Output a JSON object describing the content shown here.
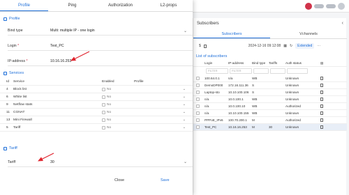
{
  "background": {
    "panel_title": "Subscribers",
    "tabs": [
      {
        "label": "Subscribers",
        "active": true
      },
      {
        "label": "Vchannels",
        "active": false
      }
    ],
    "toolbar": {
      "date": "2024-12-16 09:12:08",
      "extended_label": "Extended"
    },
    "list_title": "List of subscribers",
    "columns": [
      "Login",
      "IP-address",
      "Bind type",
      "Tariffs",
      "Auth status"
    ],
    "filter_placeholder": "FILTER",
    "rows": [
      {
        "login": "100.64.0.1",
        "ip": "n/a",
        "bind": "WB",
        "tariff": "",
        "status": "Unknown",
        "selected": false
      },
      {
        "login": "DemoDP000",
        "ip": "172.16.111.36",
        "bind": "S",
        "tariff": "",
        "status": "Unknown",
        "selected": false
      },
      {
        "login": "Laptop-sto",
        "ip": "10.10.100.106",
        "bind": "S",
        "tariff": "",
        "status": "Unknown",
        "selected": false
      },
      {
        "login": "n/a",
        "ip": "10.0.100.1",
        "bind": "WB",
        "tariff": "",
        "status": "Unknown",
        "selected": false
      },
      {
        "login": "n/a",
        "ip": "10.0.100.10",
        "bind": "WB",
        "tariff": "",
        "status": "Authorized",
        "selected": false
      },
      {
        "login": "n/a",
        "ip": "10.10.100.155",
        "bind": "WB",
        "tariff": "",
        "status": "Unknown",
        "selected": false
      },
      {
        "login": "PPPoE_IPv6",
        "ip": "100.70.200.1",
        "bind": "M",
        "tariff": "",
        "status": "Authorized",
        "selected": false
      },
      {
        "login": "Test_PC",
        "ip": "10.16.16.253",
        "bind": "M",
        "tariff": "30",
        "status": "Unknown",
        "selected": true
      }
    ]
  },
  "modal": {
    "tabs": [
      {
        "label": "Profile",
        "active": true
      },
      {
        "label": "Ping",
        "active": false
      },
      {
        "label": "Authorization",
        "active": false
      },
      {
        "label": "L2-props",
        "active": false
      }
    ],
    "profile_section": "Profile",
    "bind_type": {
      "label": "Bind type",
      "value": "Multi: multiple IP - one login"
    },
    "login": {
      "label": "Login",
      "value": "Test_PC"
    },
    "ip_address": {
      "label": "IP-address",
      "value": "10.16.16.253"
    },
    "services_section": "Services",
    "services_columns": {
      "id": "Id",
      "service": "Service",
      "enabled": "Enabled",
      "profile": "Profile"
    },
    "services": [
      {
        "id": "4",
        "name": "Block list",
        "enabled": "No"
      },
      {
        "id": "6",
        "name": "White list",
        "enabled": "No"
      },
      {
        "id": "9",
        "name": "Netflow stats",
        "enabled": "No"
      },
      {
        "id": "11",
        "name": "CGNAT",
        "enabled": "No"
      },
      {
        "id": "13",
        "name": "Mini Firewall",
        "enabled": "No"
      },
      {
        "id": "5",
        "name": "Tariff",
        "enabled": "No"
      }
    ],
    "tariff_section": "Tariff",
    "tariff": {
      "label": "Tariff",
      "value": "30"
    },
    "close_label": "Close",
    "save_label": "Save"
  },
  "colors": {
    "accent": "#1e6fd9",
    "required": "#d0334a",
    "annotation_arrow": "#e0242e"
  }
}
